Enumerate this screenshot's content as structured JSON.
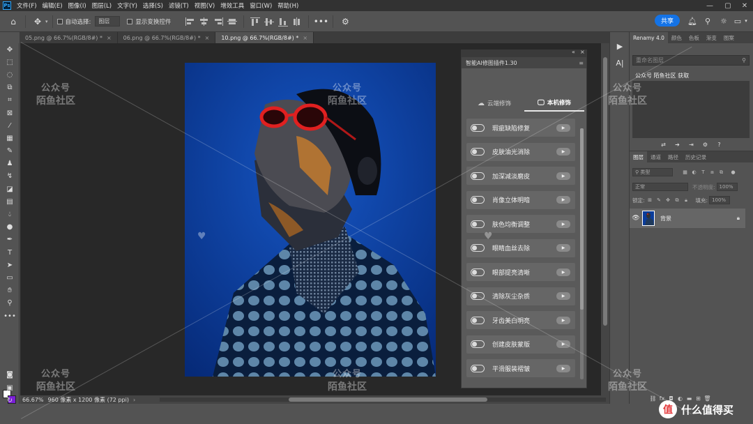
{
  "menubar": {
    "items": [
      "文件(F)",
      "编辑(E)",
      "图像(I)",
      "图层(L)",
      "文字(Y)",
      "选择(S)",
      "滤镜(T)",
      "视图(V)",
      "增效工具",
      "窗口(W)",
      "帮助(H)"
    ]
  },
  "options": {
    "auto_select_label": "自动选择:",
    "auto_select_value": "图层",
    "show_transform_label": "显示变换控件",
    "share_label": "共享"
  },
  "tabs": [
    {
      "label": "05.png @ 66.7%(RGB/8#) *",
      "active": false
    },
    {
      "label": "06.png @ 66.7%(RGB/8#) *",
      "active": false
    },
    {
      "label": "10.png @ 66.7%(RGB/8#) *",
      "active": true
    }
  ],
  "status": {
    "zoom": "66.67%",
    "info": "960 像素 x 1200 像素 (72 ppi)"
  },
  "plugin": {
    "title": "智能AI修图插件1.30",
    "tab_cloud": "云端修饰",
    "tab_local": "本机修饰",
    "features": [
      "瑕疵缺陷修复",
      "皮肤油光消除",
      "加深减淡磨皮",
      "肖像立体明暗",
      "肤色均衡调整",
      "眼睛血丝去除",
      "眼部提亮清晰",
      "清除灰尘杂质",
      "牙齿美白明亮",
      "创建皮肤蒙版",
      "平滑服装褶皱"
    ]
  },
  "right_panel": {
    "tabs": [
      "Renamy 4.0",
      "颜色",
      "色板",
      "渐变",
      "图案"
    ],
    "rename_placeholder": "重命名图层",
    "info": "公众号 陌鱼社区 获取"
  },
  "layers_panel": {
    "tabs": [
      "图层",
      "通道",
      "路径",
      "历史记录"
    ],
    "filter_label": "类型",
    "blend_mode": "正常",
    "opacity_label": "不透明度:",
    "opacity_value": "100%",
    "lock_label": "锁定:",
    "fill_label": "填充:",
    "fill_value": "100%",
    "layer_name": "背景"
  },
  "watermark": {
    "line1": "公众号",
    "line2": "陌鱼社区"
  },
  "site_logo": {
    "badge": "值",
    "text": "什么值得买"
  },
  "colors": {
    "accent_blue": "#1473e6",
    "photo_blue": "#0b3c9a",
    "background_color": "#7a1fd6"
  }
}
